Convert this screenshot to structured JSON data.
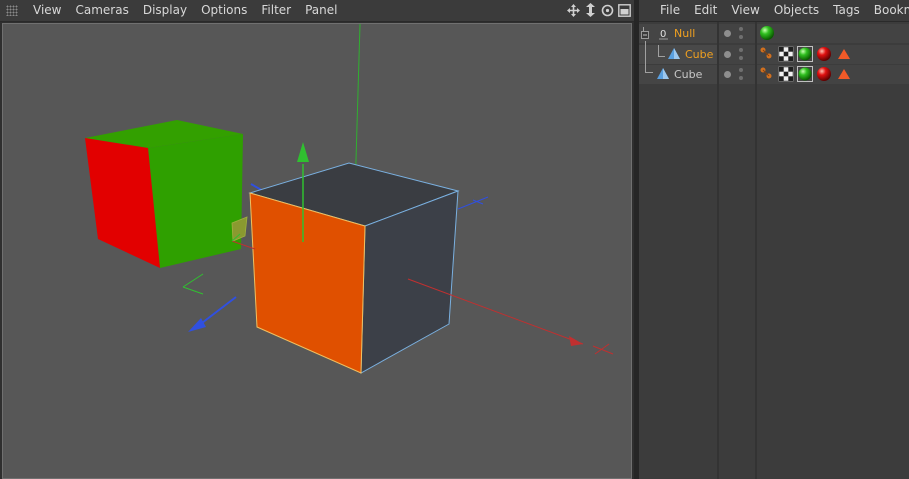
{
  "viewport": {
    "menu": [
      "View",
      "Cameras",
      "Display",
      "Options",
      "Filter",
      "Panel"
    ],
    "tool_icons": [
      "move-view-icon",
      "zoom-view-icon",
      "rotate-view-icon",
      "toggle-view-icon"
    ]
  },
  "object_manager": {
    "menu": [
      "File",
      "Edit",
      "View",
      "Objects",
      "Tags",
      "Bookmarks"
    ],
    "rows": [
      {
        "label": "Null",
        "color": "#f0a020",
        "tags": [
          "green-material"
        ]
      },
      {
        "label": "Cube",
        "color": "#f0a020",
        "tags": [
          "texture-tag",
          "checker-tag",
          "green-material",
          "red-material",
          "phong-tag"
        ]
      },
      {
        "label": "Cube",
        "color": "#c8c8c8",
        "tags": [
          "texture-tag",
          "checker-tag",
          "green-material",
          "red-material",
          "phong-tag"
        ]
      }
    ]
  },
  "scene_colors": {
    "viewport_bg": "#575757",
    "cube_top": "#3a3d42",
    "cube_front": "#e05000",
    "cube_right": "#3c4048",
    "small_cube_front": "#e20000",
    "small_cube_side": "#2fa000",
    "axis_x": "#c03030",
    "axis_y": "#30c030",
    "axis_z": "#3050e0",
    "selection_outline": "#7ab0e0"
  }
}
